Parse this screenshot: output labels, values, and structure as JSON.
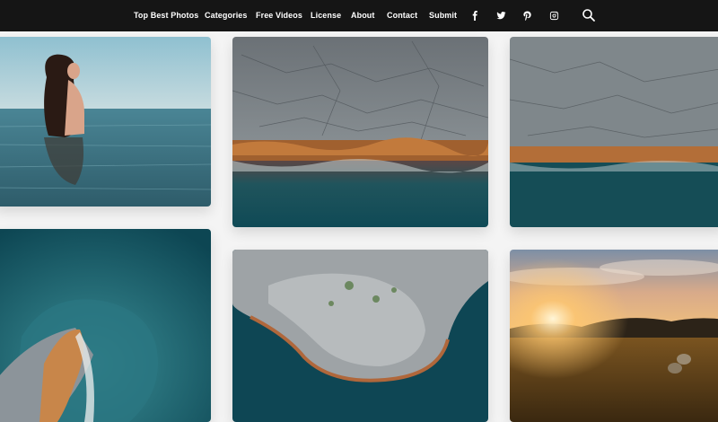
{
  "nav": {
    "items": [
      {
        "label": "Top Best Photos"
      },
      {
        "label": "Categories"
      },
      {
        "label": "Free Videos"
      },
      {
        "label": "License"
      },
      {
        "label": "About"
      },
      {
        "label": "Contact"
      },
      {
        "label": "Submit"
      }
    ],
    "social": [
      "facebook-icon",
      "twitter-icon",
      "pinterest-icon",
      "instagram-icon"
    ],
    "search_icon": "search-icon"
  },
  "photos": [
    {
      "subject": "woman-in-sea"
    },
    {
      "subject": "aerial-rocky-coast"
    },
    {
      "subject": "aerial-rocky-coast-duplicate"
    },
    {
      "subject": "aerial-island-turquoise"
    },
    {
      "subject": "aerial-rock-peninsula"
    },
    {
      "subject": "sunset-field-hay-bales"
    }
  ],
  "colors": {
    "topbar": "#151515",
    "background": "#f4f4f4",
    "nav_text": "#ffffff"
  }
}
